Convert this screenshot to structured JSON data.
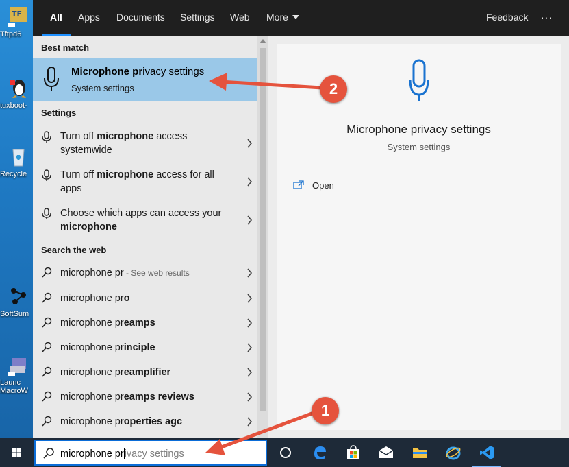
{
  "desktop": {
    "icons": [
      {
        "label": "Tftpd6",
        "icon": "tftpd-icon"
      },
      {
        "label": "tuxboot-",
        "icon": "tux-icon"
      },
      {
        "label": "Recycle",
        "icon": "recycle-bin-icon"
      },
      {
        "label": "SoftSum",
        "icon": "softsum-icon"
      },
      {
        "label": "Launc",
        "label2": "MacroW",
        "icon": "macro-launcher-icon"
      }
    ]
  },
  "search": {
    "tabs": [
      {
        "label": "All",
        "active": true
      },
      {
        "label": "Apps"
      },
      {
        "label": "Documents"
      },
      {
        "label": "Settings"
      },
      {
        "label": "Web"
      },
      {
        "label": "More"
      }
    ],
    "feedback_label": "Feedback",
    "ellipsis_label": "···",
    "best_match_heading": "Best match",
    "best_match": {
      "title_bold": "Microphone pr",
      "title_rest": "ivacy settings",
      "subtitle": "System settings"
    },
    "settings_heading": "Settings",
    "settings_items": [
      {
        "pre": "Turn off ",
        "bold": "microphone",
        "post": " access",
        "line2": "systemwide"
      },
      {
        "pre": "Turn off ",
        "bold": "microphone",
        "post": " access for all",
        "line2": "apps"
      },
      {
        "pre": "Choose which apps can access your",
        "line2_bold": "microphone"
      }
    ],
    "web_heading": "Search the web",
    "web_items": [
      {
        "pre": "microphone pr",
        "bold": "",
        "suffix": " - See web results"
      },
      {
        "pre": "microphone pr",
        "bold": "o"
      },
      {
        "pre": "microphone pr",
        "bold": "eamps"
      },
      {
        "pre": "microphone pr",
        "bold": "inciple"
      },
      {
        "pre": "microphone pr",
        "bold": "eamplifier"
      },
      {
        "pre": "microphone pr",
        "bold": "eamps reviews"
      },
      {
        "pre": "microphone pr",
        "bold": "operties agc"
      }
    ]
  },
  "preview": {
    "title": "Microphone privacy settings",
    "subtitle": "System settings",
    "open_label": "Open"
  },
  "taskbar": {
    "query_typed": "microphone pr",
    "query_hint": "ivacy settings",
    "icons": [
      "cortana-icon",
      "edge-icon",
      "store-icon",
      "mail-icon",
      "file-explorer-icon",
      "internet-explorer-icon",
      "vscode-icon"
    ]
  },
  "annotations": {
    "badge_1": "1",
    "badge_2": "2",
    "color": "#e5533d"
  }
}
